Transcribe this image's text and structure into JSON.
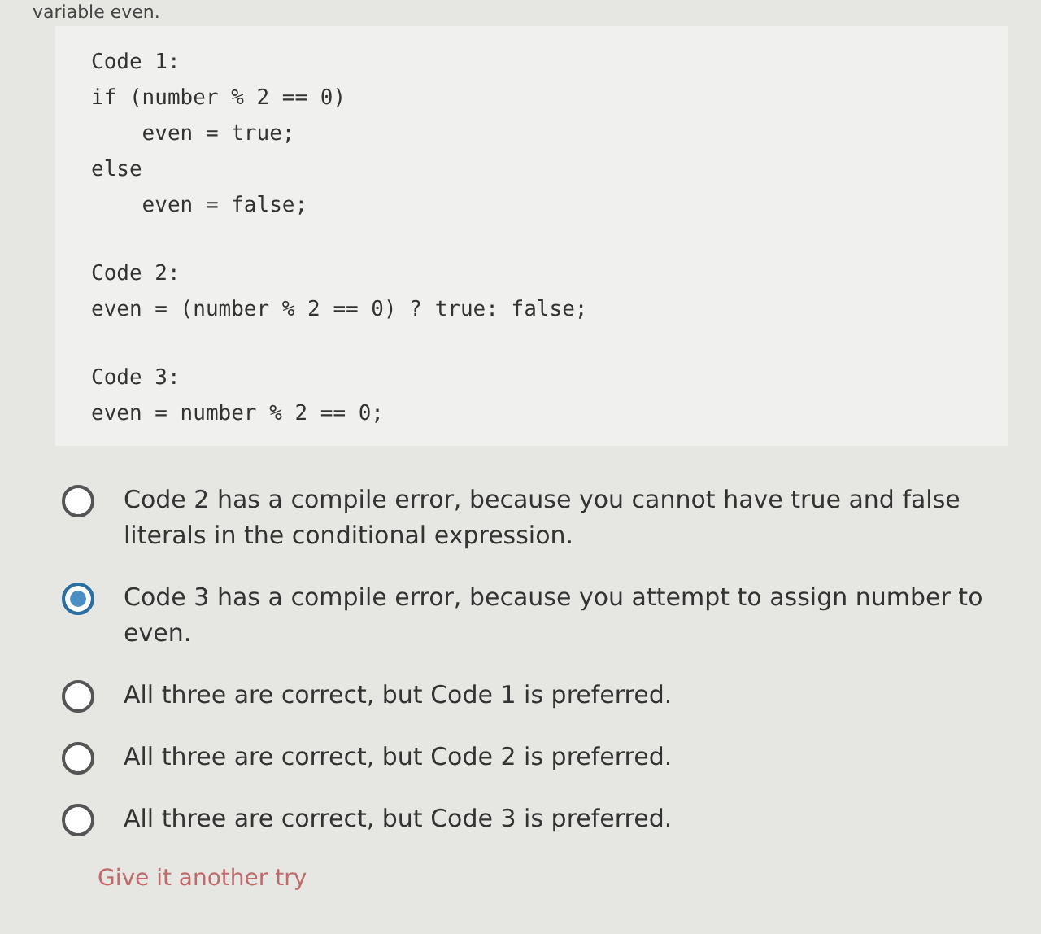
{
  "question_tail": "variable even.",
  "code_groups": [
    [
      "Code 1:",
      "if (number % 2 == 0)",
      "    even = true;",
      "else",
      "    even = false;"
    ],
    [
      "Code 2:",
      "even = (number % 2 == 0) ? true: false;"
    ],
    [
      "Code 3:",
      "even = number % 2 == 0;"
    ]
  ],
  "options": [
    {
      "label": "Code 2 has a compile error, because you cannot have true and false literals in the conditional expression.",
      "selected": false
    },
    {
      "label": "Code 3 has a compile error, because you attempt to assign number to even.",
      "selected": true
    },
    {
      "label": "All three are correct, but Code 1 is preferred.",
      "selected": false
    },
    {
      "label": "All three are correct, but Code 2 is preferred.",
      "selected": false
    },
    {
      "label": "All three are correct, but Code 3 is preferred.",
      "selected": false
    }
  ],
  "retry_link": "Give it another try"
}
